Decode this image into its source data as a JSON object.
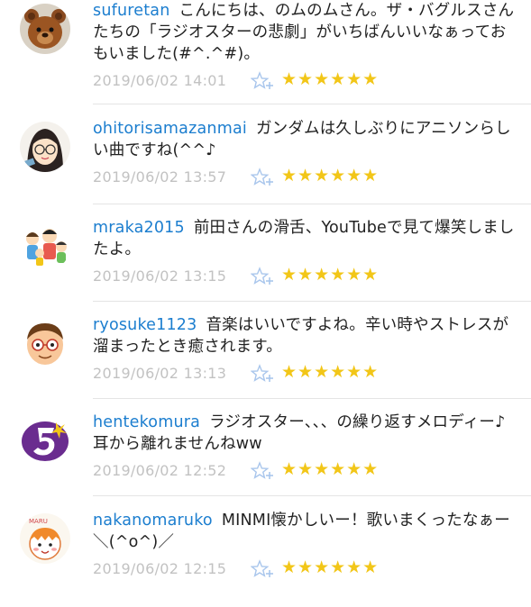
{
  "comments": [
    {
      "username": "sufuretan",
      "message": "こんにちは、のムのムさん。ザ・バグルスさんたちの「ラジオスターの悲劇」がいちばんいいなぁっておもいました(#^.^#)。",
      "timestamp": "2019/06/02 14:01",
      "stars": "★★★★★★",
      "avatar_icon": "teddy-bear"
    },
    {
      "username": "ohitorisamazanmai",
      "message": "ガンダムは久しぶりにアニソンらしい曲ですね(^^♪",
      "timestamp": "2019/06/02 13:57",
      "stars": "★★★★★★",
      "avatar_icon": "glasses-woman"
    },
    {
      "username": "mraka2015",
      "message": "前田さんの滑舌、YouTubeで見て爆笑しましたよ。",
      "timestamp": "2019/06/02 13:15",
      "stars": "★★★★★★",
      "avatar_icon": "family-illustration"
    },
    {
      "username": "ryosuke1123",
      "message": "音楽はいいですよね。辛い時やストレスが溜まったとき癒されます。",
      "timestamp": "2019/06/02 13:13",
      "stars": "★★★★★★",
      "avatar_icon": "glasses-man"
    },
    {
      "username": "hentekomura",
      "message": "ラジオスター、、、の繰り返すメロディー♪耳から離れませんねww",
      "timestamp": "2019/06/02 12:52",
      "stars": "★★★★★★",
      "avatar_icon": "purple-five-logo"
    },
    {
      "username": "nakanomaruko",
      "message": "MINMI懐かしいー！歌いまくったなぁー＼(^o^)／",
      "timestamp": "2019/06/02 12:15",
      "stars": "★★★★★★",
      "avatar_icon": "maru-character"
    }
  ],
  "colors": {
    "username": "#1c7ecf",
    "timestamp": "#c2c2c2",
    "star": "#f2c618",
    "star_add": "#a9c6ec"
  }
}
